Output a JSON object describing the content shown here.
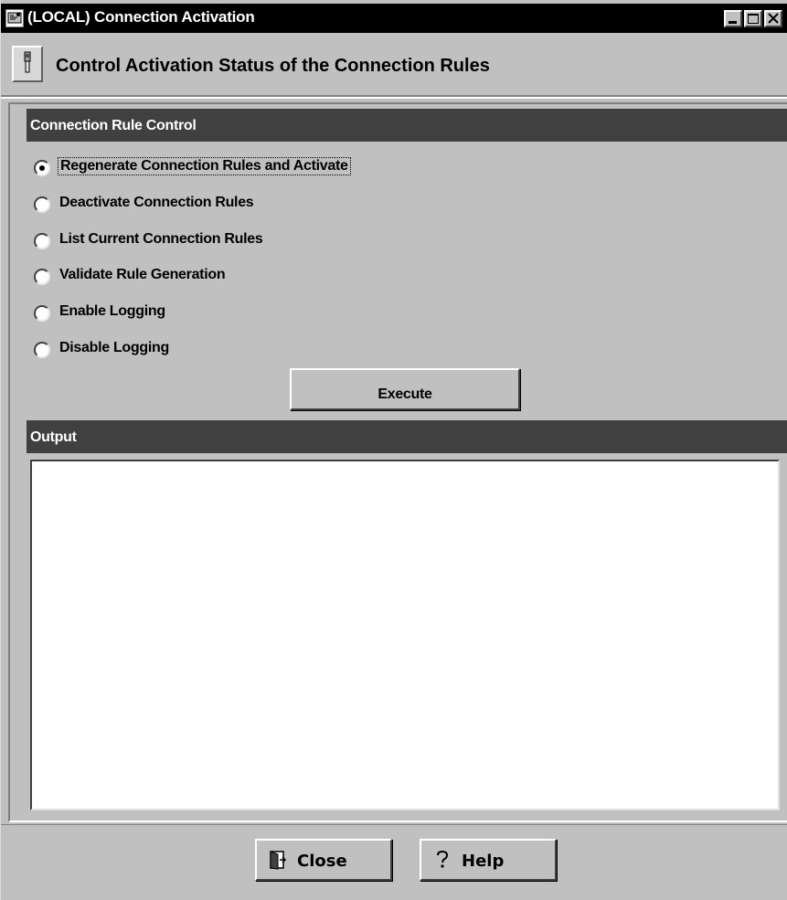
{
  "window": {
    "title": "(LOCAL) Connection Activation",
    "app_icon": "app-icon",
    "controls": [
      "minimize",
      "maximize",
      "close"
    ]
  },
  "header": {
    "icon": "connection-plug-icon",
    "title": "Control Activation Status of the Connection Rules"
  },
  "rule_control": {
    "title": "Connection Rule Control",
    "options": [
      {
        "label": "Regenerate Connection Rules and Activate",
        "selected": true
      },
      {
        "label": "Deactivate Connection Rules",
        "selected": false
      },
      {
        "label": "List Current Connection Rules",
        "selected": false
      },
      {
        "label": "Validate Rule Generation",
        "selected": false
      },
      {
        "label": "Enable Logging",
        "selected": false
      },
      {
        "label": "Disable Logging",
        "selected": false
      }
    ],
    "execute_label": "Execute"
  },
  "output": {
    "title": "Output",
    "text": ""
  },
  "footer": {
    "close_label": "Close",
    "close_icon": "door-exit-icon",
    "help_label": "Help",
    "help_icon": "question-mark-icon"
  },
  "colors": {
    "window_bg": "#c0c0c0",
    "section_header_bg": "#404040",
    "section_header_text": "#ffffff",
    "titlebar_bg": "#000000",
    "output_bg": "#ffffff"
  }
}
